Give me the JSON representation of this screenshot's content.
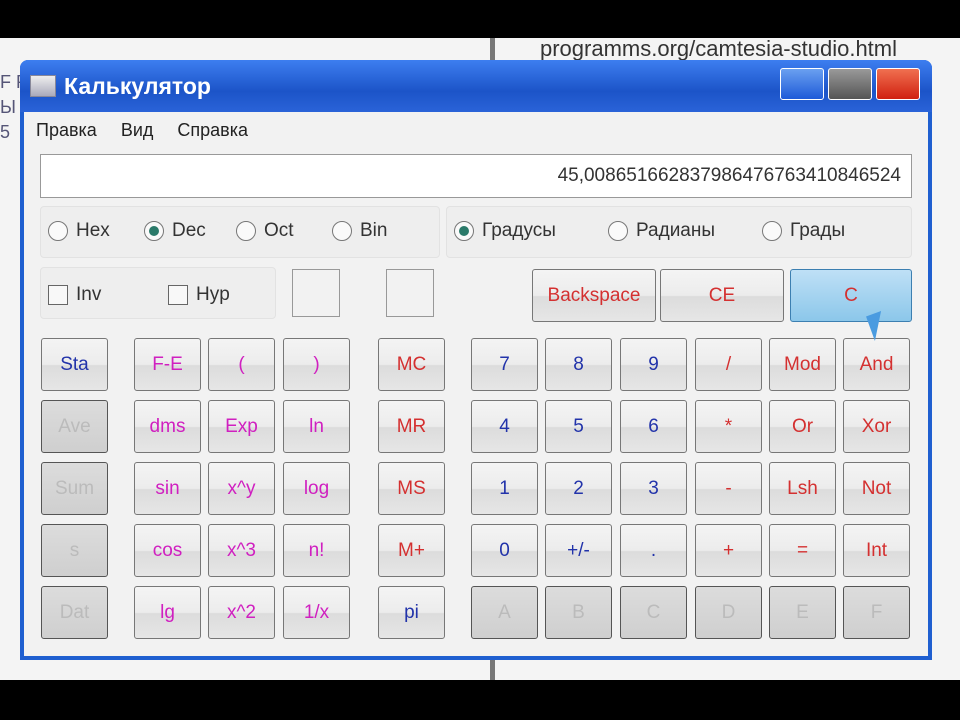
{
  "background": {
    "url": "programms.org/camtesia-studio.html",
    "left_fragments": [
      "F P",
      "Ы",
      "5"
    ]
  },
  "window": {
    "title": "Калькулятор",
    "controls": [
      "minimize",
      "maximize",
      "close"
    ]
  },
  "menu": [
    "Правка",
    "Вид",
    "Справка"
  ],
  "display": {
    "value": "45,008651662837986476763410846524"
  },
  "base_modes": [
    {
      "label": "Hex",
      "selected": false
    },
    {
      "label": "Dec",
      "selected": true
    },
    {
      "label": "Oct",
      "selected": false
    },
    {
      "label": "Bin",
      "selected": false
    }
  ],
  "angle_modes": [
    {
      "label": "Градусы",
      "selected": true
    },
    {
      "label": "Радианы",
      "selected": false
    },
    {
      "label": "Грады",
      "selected": false
    }
  ],
  "checks": [
    {
      "label": "Inv",
      "checked": false
    },
    {
      "label": "Hyp",
      "checked": false
    }
  ],
  "top_buttons": {
    "backspace": "Backspace",
    "ce": "CE",
    "c": "C"
  },
  "stat_buttons": [
    "Sta",
    "Ave",
    "Sum",
    "s",
    "Dat"
  ],
  "sci_rows": [
    [
      "F-E",
      "(",
      ")"
    ],
    [
      "dms",
      "Exp",
      "ln"
    ],
    [
      "sin",
      "x^y",
      "log"
    ],
    [
      "cos",
      "x^3",
      "n!"
    ],
    [
      "lg",
      "x^2",
      "1/x"
    ]
  ],
  "mem_buttons": [
    "MC",
    "MR",
    "MS",
    "M+",
    "pi"
  ],
  "num_rows": [
    [
      "7",
      "8",
      "9",
      "/",
      "Mod",
      "And"
    ],
    [
      "4",
      "5",
      "6",
      "*",
      "Or",
      "Xor"
    ],
    [
      "1",
      "2",
      "3",
      "-",
      "Lsh",
      "Not"
    ],
    [
      "0",
      "+/-",
      ".",
      "+",
      "=",
      "Int"
    ],
    [
      "A",
      "B",
      "C",
      "D",
      "E",
      "F"
    ]
  ],
  "colors": {
    "title_bar": "#1f5fd0",
    "digit": "#2233aa",
    "function": "#d020c0",
    "operator": "#d43030",
    "c_button": "#8cc7ea"
  }
}
